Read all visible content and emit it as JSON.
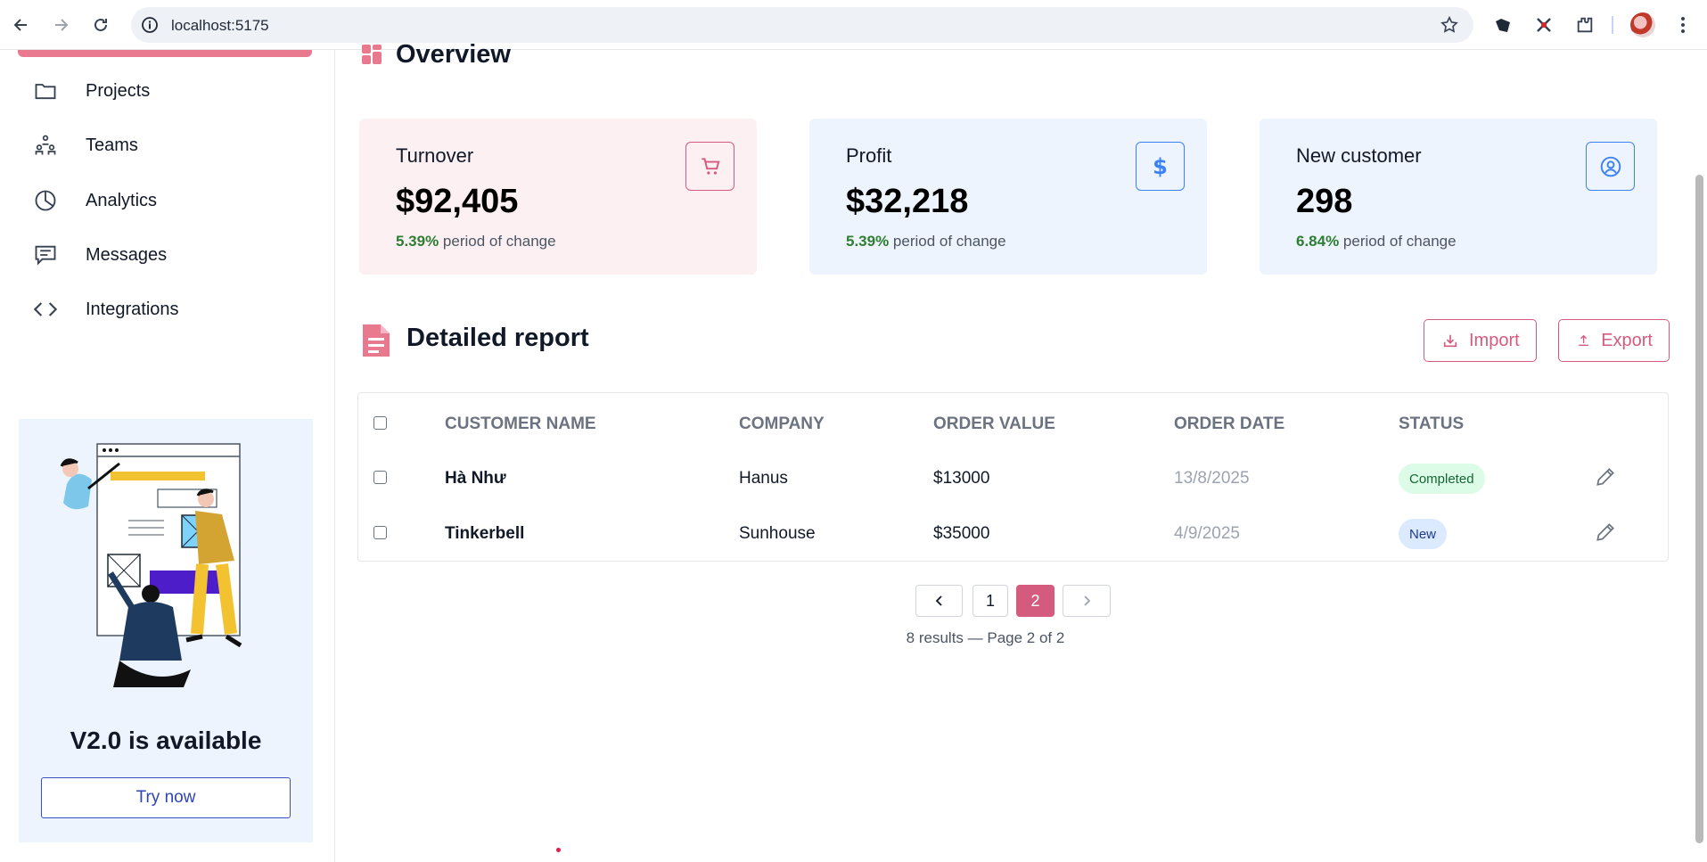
{
  "browser": {
    "url": "localhost:5175"
  },
  "sidebar": {
    "items": [
      {
        "label": "Projects",
        "icon": "folder-icon"
      },
      {
        "label": "Teams",
        "icon": "teams-icon"
      },
      {
        "label": "Analytics",
        "icon": "pie-chart-icon"
      },
      {
        "label": "Messages",
        "icon": "message-icon"
      },
      {
        "label": "Integrations",
        "icon": "code-icon"
      }
    ],
    "promo": {
      "title": "V2.0 is available",
      "button": "Try now"
    }
  },
  "overview": {
    "title": "Overview",
    "cards": [
      {
        "label": "Turnover",
        "value": "$92,405",
        "pct": "5.39%",
        "change": " period of change",
        "icon": "cart-icon",
        "bg": "#fdf0f3",
        "accent": "#d45a7e"
      },
      {
        "label": "Profit",
        "value": "$32,218",
        "pct": "5.39%",
        "change": " period of change",
        "icon": "dollar-icon",
        "bg": "#eef4fd",
        "accent": "#3b82f6"
      },
      {
        "label": "New customer",
        "value": "298",
        "pct": "6.84%",
        "change": " period of change",
        "icon": "user-circle-icon",
        "bg": "#eef4fd",
        "accent": "#3b82f6"
      }
    ]
  },
  "report": {
    "title": "Detailed report",
    "import_label": "Import",
    "export_label": "Export",
    "columns": [
      "CUSTOMER NAME",
      "COMPANY",
      "ORDER VALUE",
      "ORDER DATE",
      "STATUS"
    ],
    "rows": [
      {
        "name": "Hà Như",
        "company": "Hanus",
        "value": "$13000",
        "date": "13/8/2025",
        "status": "Completed"
      },
      {
        "name": "Tinkerbell",
        "company": "Sunhouse",
        "value": "$35000",
        "date": "4/9/2025",
        "status": "New"
      }
    ],
    "pagination": {
      "pages": [
        "1",
        "2"
      ],
      "current": "2",
      "summary": "8 results — Page 2 of 2"
    }
  },
  "colors": {
    "brand_pink": "#d45a7e",
    "completed_bg": "#dcfce7",
    "completed_text": "#166534",
    "new_bg": "#dbeafe",
    "new_text": "#1e3a8a",
    "change_green": "#2e7d32"
  }
}
